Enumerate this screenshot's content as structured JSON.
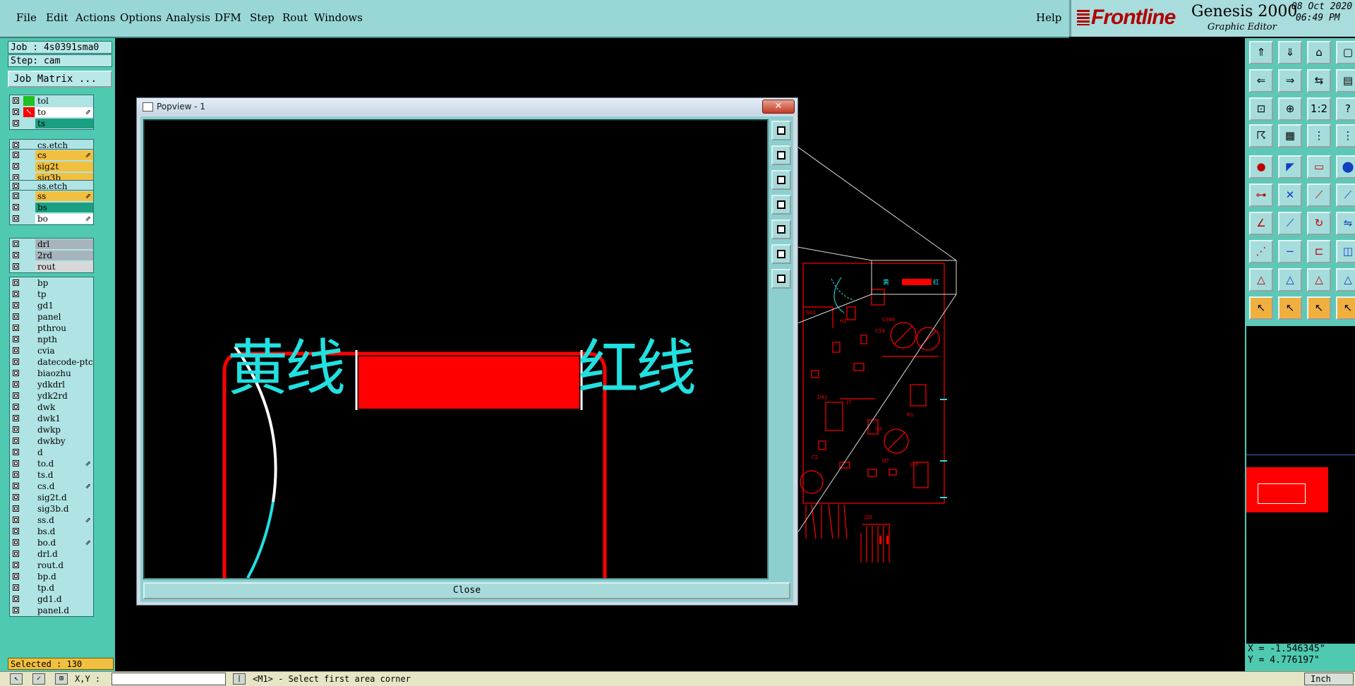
{
  "menu": {
    "items": [
      "File",
      "Edit",
      "Actions",
      "Options",
      "Analysis",
      "DFM",
      "Step",
      "Rout",
      "Windows"
    ],
    "help": "Help"
  },
  "brand": {
    "logo": "Frontline",
    "product": "Genesis 2000",
    "subtitle": "Graphic Editor",
    "date": "08 Oct 2020",
    "time": "06:49 PM"
  },
  "job": {
    "job_label": "Job : 4s0391sma0",
    "step_label": "Step: cam",
    "matrix_button": "Job Matrix ..."
  },
  "layer_groups": [
    [
      {
        "name": "tol",
        "state": "green",
        "color": "#b0e4e4"
      },
      {
        "name": "to",
        "state": "red-arrow",
        "color": "#ffffff",
        "mark": "⇗"
      },
      {
        "name": "ts",
        "state": "",
        "color": "#1aa080"
      }
    ],
    [
      {
        "name": "cs.etch",
        "state": "",
        "color": "#b0e4e4"
      }
    ],
    [
      {
        "name": "cs",
        "state": "",
        "color": "#f2c040",
        "mark": "⇗"
      },
      {
        "name": "sig2t",
        "state": "",
        "color": "#f2c040"
      },
      {
        "name": "sig3b",
        "state": "",
        "color": "#f2c040"
      }
    ],
    [
      {
        "name": "ss.etch",
        "state": "",
        "color": "#b0e4e4"
      }
    ],
    [
      {
        "name": "ss",
        "state": "",
        "color": "#f2c040",
        "mark": "⇗"
      },
      {
        "name": "bs",
        "state": "",
        "color": "#1aa080"
      },
      {
        "name": "bo",
        "state": "",
        "color": "#ffffff",
        "mark": "⇗"
      }
    ],
    [
      {
        "name": "drl",
        "state": "",
        "color": "#a8b4bc"
      },
      {
        "name": "2rd",
        "state": "",
        "color": "#a8b4bc"
      },
      {
        "name": "rout",
        "state": "",
        "color": "#d8d8d8"
      }
    ],
    [
      {
        "name": "bp",
        "state": "",
        "color": "#b0e4e4"
      },
      {
        "name": "tp",
        "state": "",
        "color": "#b0e4e4"
      },
      {
        "name": "gd1",
        "state": "",
        "color": "#b0e4e4"
      },
      {
        "name": "panel",
        "state": "",
        "color": "#b0e4e4"
      },
      {
        "name": "pthrou",
        "state": "",
        "color": "#b0e4e4"
      },
      {
        "name": "npth",
        "state": "",
        "color": "#b0e4e4"
      },
      {
        "name": "cvia",
        "state": "",
        "color": "#b0e4e4"
      },
      {
        "name": "datecode-ptc",
        "state": "",
        "color": "#b0e4e4"
      },
      {
        "name": "biaozhu",
        "state": "",
        "color": "#b0e4e4"
      },
      {
        "name": "ydkdrl",
        "state": "",
        "color": "#b0e4e4"
      },
      {
        "name": "ydk2rd",
        "state": "",
        "color": "#b0e4e4"
      },
      {
        "name": "dwk",
        "state": "",
        "color": "#b0e4e4"
      },
      {
        "name": "dwk1",
        "state": "",
        "color": "#b0e4e4"
      },
      {
        "name": "dwkp",
        "state": "",
        "color": "#b0e4e4"
      },
      {
        "name": "dwkby",
        "state": "",
        "color": "#b0e4e4"
      },
      {
        "name": "d",
        "state": "",
        "color": "#b0e4e4"
      },
      {
        "name": "to.d",
        "state": "",
        "color": "#b0e4e4",
        "mark": "⇗"
      },
      {
        "name": "ts.d",
        "state": "",
        "color": "#b0e4e4"
      },
      {
        "name": "cs.d",
        "state": "",
        "color": "#b0e4e4",
        "mark": "⇗"
      },
      {
        "name": "sig2t.d",
        "state": "",
        "color": "#b0e4e4"
      },
      {
        "name": "sig3b.d",
        "state": "",
        "color": "#b0e4e4"
      },
      {
        "name": "ss.d",
        "state": "",
        "color": "#b0e4e4",
        "mark": "⇗"
      },
      {
        "name": "bs.d",
        "state": "",
        "color": "#b0e4e4"
      },
      {
        "name": "bo.d",
        "state": "",
        "color": "#b0e4e4",
        "mark": "⇗"
      },
      {
        "name": "drl.d",
        "state": "",
        "color": "#b0e4e4"
      },
      {
        "name": "rout.d",
        "state": "",
        "color": "#b0e4e4"
      },
      {
        "name": "bp.d",
        "state": "",
        "color": "#b0e4e4"
      },
      {
        "name": "tp.d",
        "state": "",
        "color": "#b0e4e4"
      },
      {
        "name": "gd1.d",
        "state": "",
        "color": "#b0e4e4"
      },
      {
        "name": "panel.d",
        "state": "",
        "color": "#b0e4e4"
      }
    ]
  ],
  "selected": "Selected : 130",
  "popview": {
    "title": "Popview - 1",
    "close_x": "✕",
    "close_button": "Close",
    "label_left": "黄线",
    "label_right": "红线"
  },
  "coords": {
    "x": "X = -1.546345\"",
    "y": "Y = 4.776197\""
  },
  "statusbar": {
    "xy_label": "X,Y :",
    "prompt": "<M1> - Select first area corner",
    "units": "Inch"
  },
  "colors": {
    "menubar": "#99d6d6",
    "panel": "#4fc9b0",
    "highlight_layer": "#f2c040",
    "pcb_trace": "#ff0000",
    "text_cyan": "#22e0e0"
  }
}
